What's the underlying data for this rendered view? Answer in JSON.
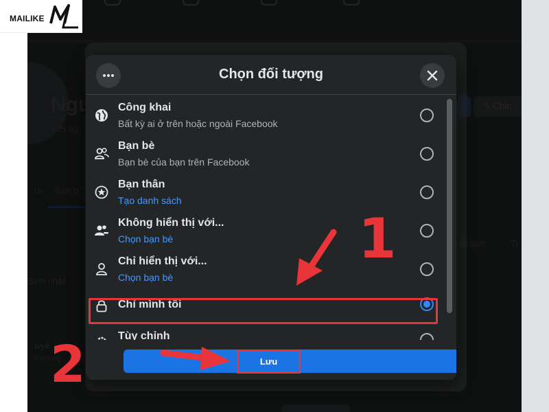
{
  "logo": {
    "text": "MAILIKE",
    "mark": "ML"
  },
  "background_profile": {
    "name_fragment": "Ngu",
    "friends_fragment": "495 ng",
    "edit_fragment": "Chỉn",
    "tab_fragment": "Bạn b",
    "section_1_fragment": "Sinh nhật",
    "section_2_fragment": "uyễ",
    "section_3_fragment": "n chung",
    "right_fragment_1": "ật bạn",
    "right_fragment_2": "Ti"
  },
  "modal": {
    "title": "Chọn đối tượng",
    "more_icon": "more-horizontal-icon",
    "close_icon": "close-icon",
    "options": [
      {
        "label": "Công khai",
        "sub": "Bất kỳ ai ở trên hoặc ngoài Facebook",
        "sub_is_link": false,
        "icon": "globe-icon",
        "selected": false
      },
      {
        "label": "Bạn bè",
        "sub": "Bạn bè của bạn trên Facebook",
        "sub_is_link": false,
        "icon": "friends-icon",
        "selected": false
      },
      {
        "label": "Bạn thân",
        "sub": "Tạo danh sách",
        "sub_is_link": true,
        "icon": "star-circle-icon",
        "selected": false
      },
      {
        "label": "Không hiển thị với...",
        "sub": "Chọn bạn bè",
        "sub_is_link": true,
        "icon": "friends-minus-icon",
        "selected": false
      },
      {
        "label": "Chỉ hiển thị với...",
        "sub": "Chọn bạn bè",
        "sub_is_link": true,
        "icon": "person-icon",
        "selected": false
      },
      {
        "label": "Chỉ mình tôi",
        "sub": "",
        "sub_is_link": false,
        "icon": "lock-icon",
        "selected": true
      },
      {
        "label": "Tùy chỉnh",
        "sub": "",
        "sub_is_link": false,
        "icon": "gear-icon",
        "selected": false
      }
    ],
    "save_label": "Lưu"
  },
  "annotations": {
    "step_1": "1",
    "step_2": "2"
  },
  "colors": {
    "accent_blue": "#1b74e4",
    "link_blue": "#4599ff",
    "annotation_red": "#e8353a",
    "modal_bg": "#242526",
    "page_bg": "#18191a"
  }
}
